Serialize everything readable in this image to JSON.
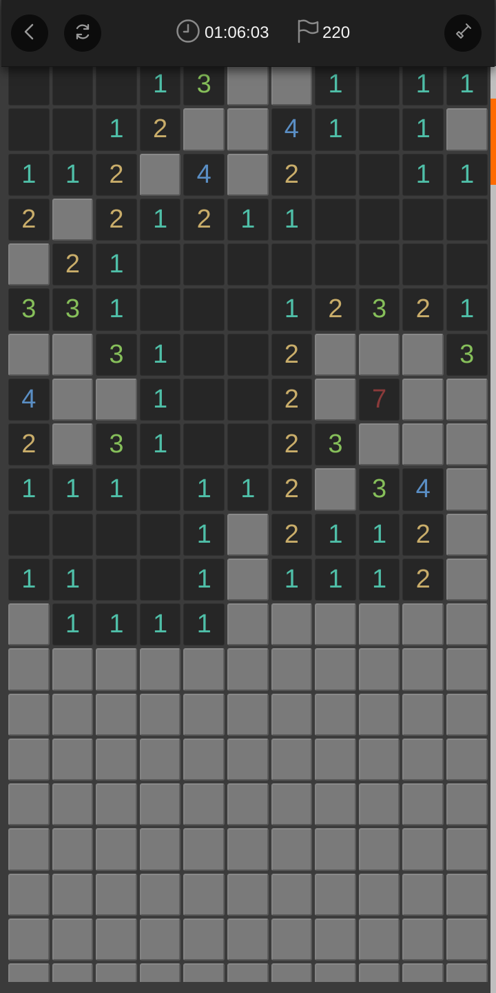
{
  "header": {
    "back_icon": "chevron-left-icon",
    "restart_icon": "refresh-icon",
    "timer_icon": "clock-icon",
    "timer": "01:06:03",
    "flag_icon": "flag-icon",
    "flags_remaining": "220",
    "mode_icon": "shovel-icon"
  },
  "colors": {
    "1": "#4fbfa8",
    "2": "#c9ad6a",
    "3": "#86bf5a",
    "4": "#5a8ec4",
    "7": "#8a3a3a",
    "accent": "#ff6a00"
  },
  "board": {
    "columns": 11,
    "legend": "'.' = revealed empty, '#' = unrevealed, digit = revealed count",
    "rows": [
      "...13##1.11",
      "..12##41.1#",
      "112#4#2..11",
      "2#21211....",
      "#21........",
      "331...12321",
      "##31..2###3",
      "4##1..2#7##",
      "2#31..23###",
      "111.112#34#",
      "....1#2112#",
      "11..1#1112#",
      "#1111######",
      "###########",
      "###########",
      "###########",
      "###########",
      "###########",
      "###########",
      "###########",
      "###########"
    ]
  }
}
